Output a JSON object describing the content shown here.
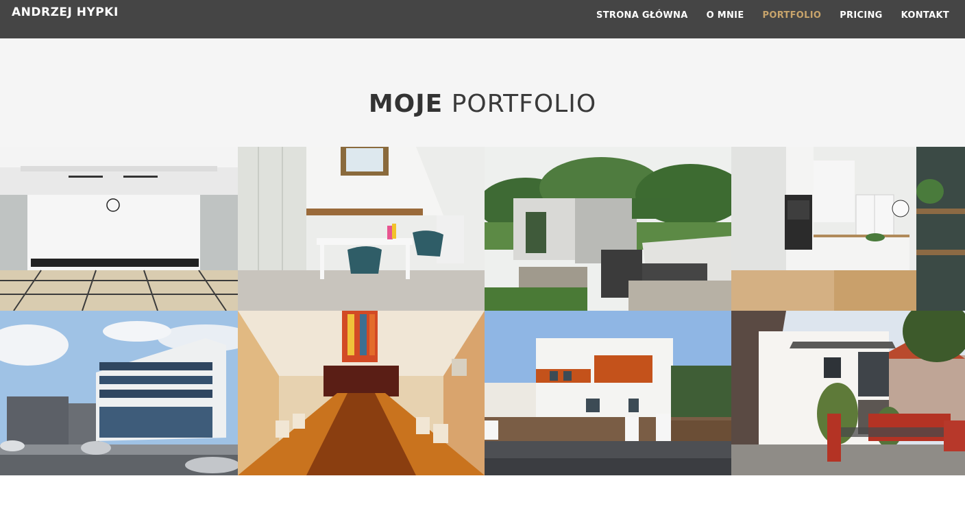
{
  "header": {
    "brand": "ANDRZEJ HYPKI",
    "nav": [
      {
        "label": "STRONA GŁÓWNA",
        "active": false
      },
      {
        "label": "O MNIE",
        "active": false
      },
      {
        "label": "PORTFOLIO",
        "active": true
      },
      {
        "label": "PRICING",
        "active": false
      },
      {
        "label": "KONTAKT",
        "active": false
      }
    ]
  },
  "hero": {
    "title_strong": "MOJE",
    "title_light": "PORTFOLIO"
  },
  "colors": {
    "navbar_bg": "#454545",
    "active_nav": "#c8a46b",
    "hero_bg": "#f5f5f5"
  },
  "portfolio": [
    {
      "subject": "hall-interior"
    },
    {
      "subject": "attic-office"
    },
    {
      "subject": "garden-pavilion"
    },
    {
      "subject": "white-kitchen"
    },
    {
      "subject": "office-building"
    },
    {
      "subject": "conference-room"
    },
    {
      "subject": "modern-house-orange"
    },
    {
      "subject": "white-house-brick-fence"
    }
  ]
}
